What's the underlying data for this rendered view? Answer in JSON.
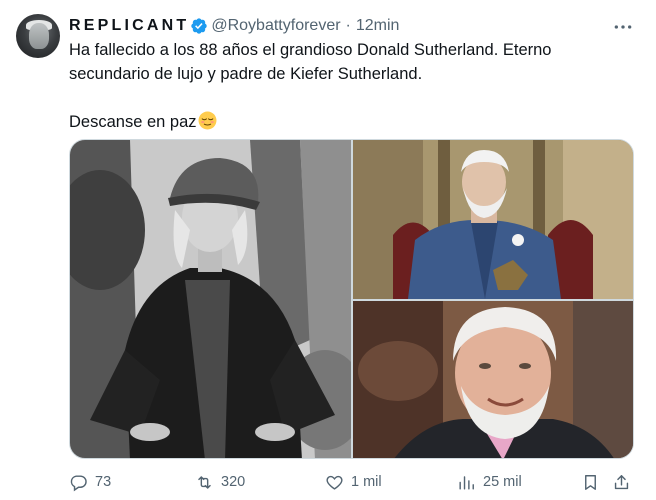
{
  "author": {
    "display_name": "REPLICANT",
    "handle": "@Roybattyforever",
    "separator": "·",
    "time": "12min"
  },
  "tweet": {
    "paragraph1": "Ha fallecido a los 88 años el grandioso Donald Sutherland. Eterno secundario de lujo y padre de Kiefer Sutherland.",
    "paragraph2": "Descanse en paz"
  },
  "media": {
    "photos": [
      "black-and-white-portrait",
      "man-in-blue-uniform-on-throne",
      "smiling-older-man-closeup"
    ]
  },
  "actions": {
    "replies": "73",
    "retweets": "320",
    "likes": "1 mil",
    "views": "25 mil"
  },
  "icons": {
    "verified": "verified-badge-icon",
    "more": "more-icon",
    "reply": "reply-icon",
    "retweet": "retweet-icon",
    "like": "heart-icon",
    "views": "views-icon",
    "bookmark": "bookmark-icon",
    "share": "share-icon",
    "emoji": "relieved-face-emoji"
  },
  "colors": {
    "accent": "#1d9bf0",
    "text_primary": "#0f1419",
    "text_secondary": "#536471",
    "border": "#cfd9de"
  }
}
